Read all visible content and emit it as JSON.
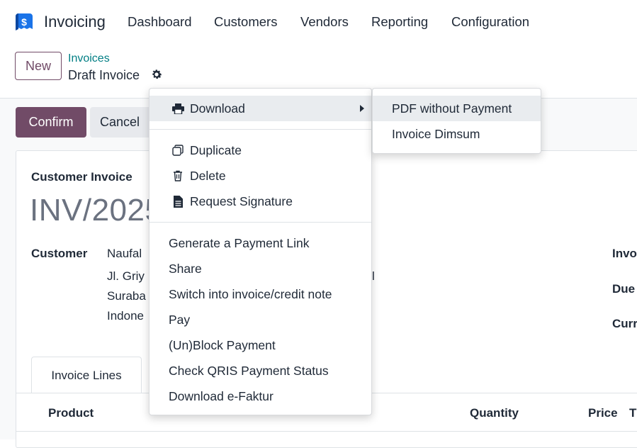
{
  "navbar": {
    "app_title": "Invoicing",
    "items": [
      "Dashboard",
      "Customers",
      "Vendors",
      "Reporting",
      "Configuration"
    ]
  },
  "control_panel": {
    "new_label": "New",
    "breadcrumb": "Invoices",
    "record_name": "Draft Invoice"
  },
  "status_bar": {
    "confirm_label": "Confirm",
    "cancel_label": "Cancel"
  },
  "form": {
    "move_type": "Customer Invoice",
    "name": "INV/2025",
    "customer_label": "Customer",
    "customer_address": [
      "Naufal",
      "Jl. Griy",
      "Suraba",
      "Indone"
    ],
    "address_overflow": "l",
    "right_labels": [
      "Invo",
      "Due",
      "Curr"
    ],
    "tab_label": "Invoice Lines",
    "columns": [
      "Product",
      "Quantity",
      "Price",
      "T"
    ]
  },
  "action_menu": {
    "download": "Download",
    "group1": [
      "Duplicate",
      "Delete",
      "Request Signature"
    ],
    "group2": [
      "Generate a Payment Link",
      "Share",
      "Switch into invoice/credit note",
      "Pay",
      "(Un)Block Payment",
      "Check QRIS Payment Status",
      "Download e-Faktur"
    ]
  },
  "download_submenu": [
    "PDF without Payment",
    "Invoice Dimsum"
  ],
  "colors": {
    "brand": "#714b67",
    "link": "#017e84",
    "logo": "#1a73e8"
  }
}
